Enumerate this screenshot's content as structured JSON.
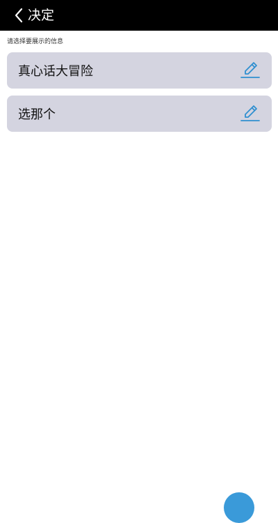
{
  "header": {
    "title": "决定",
    "back_icon": "chevron-left-icon"
  },
  "hint": "请选择要展示的信息",
  "items": [
    {
      "label": "真心话大冒险",
      "icon": "pencil-edit-icon"
    },
    {
      "label": "选那个",
      "icon": "pencil-edit-icon"
    }
  ],
  "colors": {
    "header_bg": "#000000",
    "item_bg": "#d4d4e0",
    "accent": "#2f8fd0"
  }
}
